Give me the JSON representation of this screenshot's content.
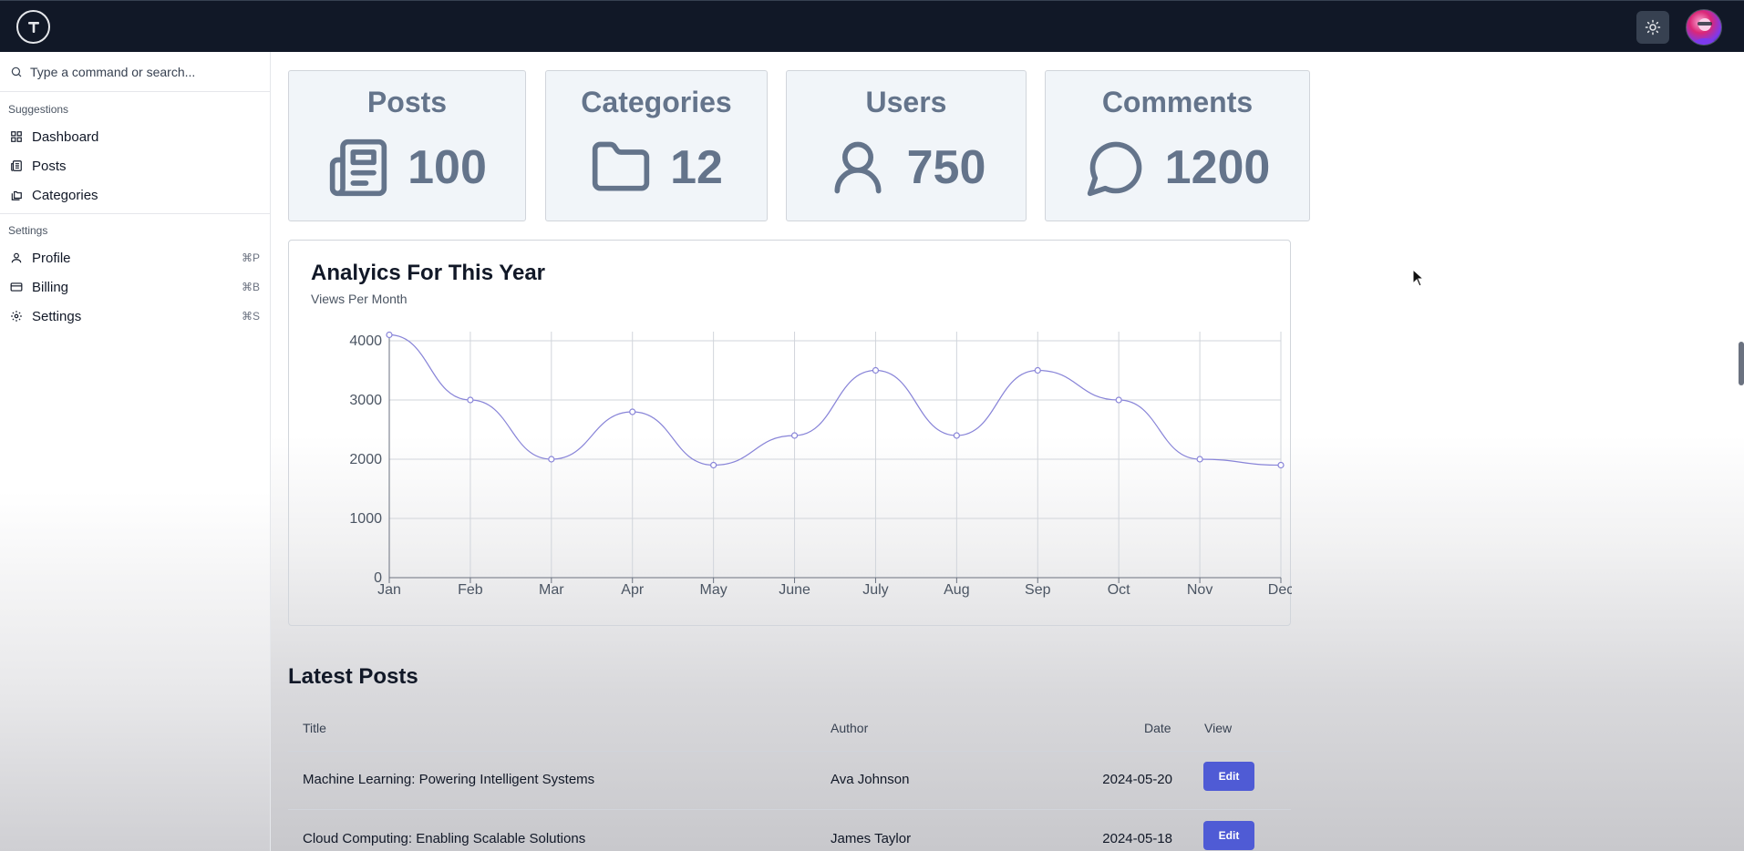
{
  "topbar": {
    "logo_icon": "t-logo-icon",
    "theme_icon": "sun-icon",
    "avatar_icon": "user-avatar"
  },
  "sidebar": {
    "search": {
      "placeholder": "Type a command or search..."
    },
    "groups": [
      {
        "label": "Suggestions",
        "items": [
          {
            "label": "Dashboard",
            "icon": "dashboard-grid-icon"
          },
          {
            "label": "Posts",
            "icon": "newspaper-icon"
          },
          {
            "label": "Categories",
            "icon": "folders-icon"
          }
        ]
      },
      {
        "label": "Settings",
        "items": [
          {
            "label": "Profile",
            "icon": "user-icon",
            "shortcut": "⌘P"
          },
          {
            "label": "Billing",
            "icon": "credit-card-icon",
            "shortcut": "⌘B"
          },
          {
            "label": "Settings",
            "icon": "gear-icon",
            "shortcut": "⌘S"
          }
        ]
      }
    ]
  },
  "stats": [
    {
      "title": "Posts",
      "value": "100",
      "icon": "newspaper-icon"
    },
    {
      "title": "Categories",
      "value": "12",
      "icon": "folder-icon"
    },
    {
      "title": "Users",
      "value": "750",
      "icon": "user-icon"
    },
    {
      "title": "Comments",
      "value": "1200",
      "icon": "message-circle-icon"
    }
  ],
  "chart": {
    "title": "Analyics For This Year",
    "subtitle": "Views Per Month"
  },
  "chart_data": {
    "type": "line",
    "categories": [
      "Jan",
      "Feb",
      "Mar",
      "Apr",
      "May",
      "June",
      "July",
      "Aug",
      "Sep",
      "Oct",
      "Nov",
      "Dec"
    ],
    "series": [
      {
        "values": [
          4100,
          3000,
          2000,
          2800,
          1900,
          2400,
          3500,
          2400,
          3500,
          3000,
          2000,
          1900
        ]
      }
    ],
    "ylim": [
      0,
      4000
    ],
    "yticks": [
      "0",
      "1000",
      "2000",
      "3000",
      "4000"
    ],
    "grid": true,
    "line_color": "#8884d8"
  },
  "latest_posts": {
    "title": "Latest Posts",
    "columns": [
      "Title",
      "Author",
      "Date",
      "View"
    ],
    "rows": [
      {
        "title": "Machine Learning: Powering Intelligent Systems",
        "author": "Ava Johnson",
        "date": "2024-05-20",
        "action": "Edit"
      },
      {
        "title": "Cloud Computing: Enabling Scalable Solutions",
        "author": "James Taylor",
        "date": "2024-05-18",
        "action": "Edit"
      }
    ]
  }
}
